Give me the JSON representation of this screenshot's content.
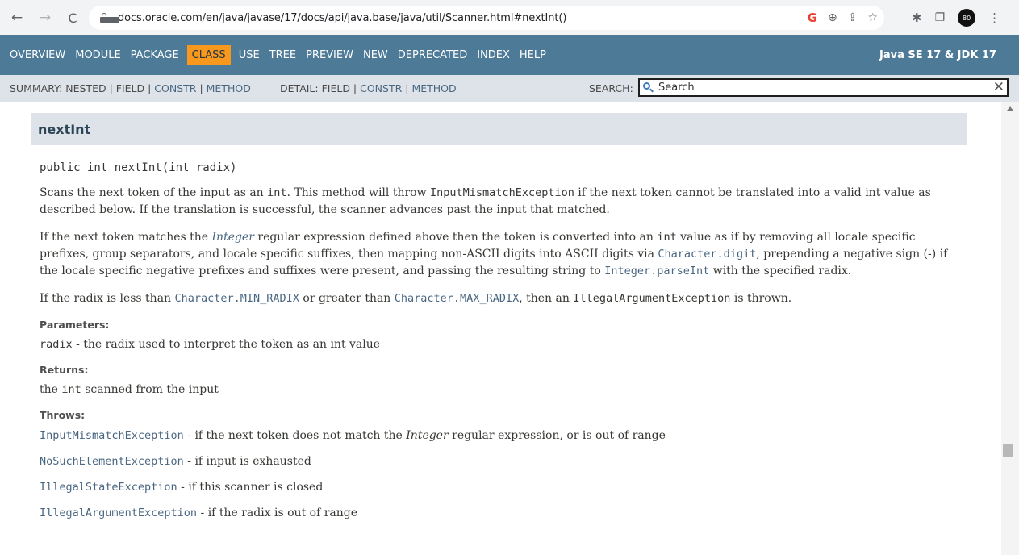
{
  "browser": {
    "url": "docs.oracle.com/en/java/javase/17/docs/api/java.base/java/util/Scanner.html#nextInt()",
    "avatar_text": "80"
  },
  "topnav": {
    "items": [
      "OVERVIEW",
      "MODULE",
      "PACKAGE",
      "CLASS",
      "USE",
      "TREE",
      "PREVIEW",
      "NEW",
      "DEPRECATED",
      "INDEX",
      "HELP"
    ],
    "active": "CLASS",
    "brand": "Java SE 17 & JDK 17"
  },
  "subnav": {
    "summary_prefix": "SUMMARY: NESTED | FIELD | ",
    "summary_constr": "CONSTR",
    "summary_sep": " | ",
    "summary_method": "METHOD",
    "detail_prefix": "DETAIL: FIELD | ",
    "detail_constr": "CONSTR",
    "detail_sep": " | ",
    "detail_method": "METHOD",
    "search_label": "SEARCH:",
    "search_placeholder": "Search"
  },
  "method": {
    "heading": "nextInt",
    "signature": "public int nextInt(int radix)",
    "p1": {
      "t1": "Scans the next token of the input as an ",
      "c1": "int",
      "t2": ". This method will throw ",
      "c2": "InputMismatchException",
      "t3": " if the next token cannot be translated into a valid int value as described below. If the translation is successful, the scanner advances past the input that matched."
    },
    "p2": {
      "t1": "If the next token matches the ",
      "e1": "Integer",
      "t2": " regular expression defined above then the token is converted into an ",
      "c1": "int",
      "t3": " value as if by removing all locale specific prefixes, group separators, and locale specific suffixes, then mapping non-ASCII digits into ASCII digits via ",
      "l1": "Character.digit",
      "t4": ", prepending a negative sign (-) if the locale specific negative prefixes and suffixes were present, and passing the resulting string to ",
      "l2": "Integer.parseInt",
      "t5": " with the specified radix."
    },
    "p3": {
      "t1": "If the radix is less than ",
      "l1": "Character.MIN_RADIX",
      "t2": " or greater than ",
      "l2": "Character.MAX_RADIX",
      "t3": ", then an ",
      "c1": "IllegalArgumentException",
      "t4": " is thrown."
    },
    "parameters_label": "Parameters:",
    "param_name": "radix",
    "param_desc": " - the radix used to interpret the token as an int value",
    "returns_label": "Returns:",
    "returns_t1": "the ",
    "returns_code": "int",
    "returns_t2": " scanned from the input",
    "throws_label": "Throws:",
    "throws": [
      {
        "ex": "InputMismatchException",
        "t1": " - if the next token does not match the ",
        "em": "Integer",
        "t2": " regular expression, or is out of range"
      },
      {
        "ex": "NoSuchElementException",
        "t1": " - if input is exhausted"
      },
      {
        "ex": "IllegalStateException",
        "t1": " - if this scanner is closed"
      },
      {
        "ex": "IllegalArgumentException",
        "t1": " - if the radix is out of range"
      }
    ]
  }
}
